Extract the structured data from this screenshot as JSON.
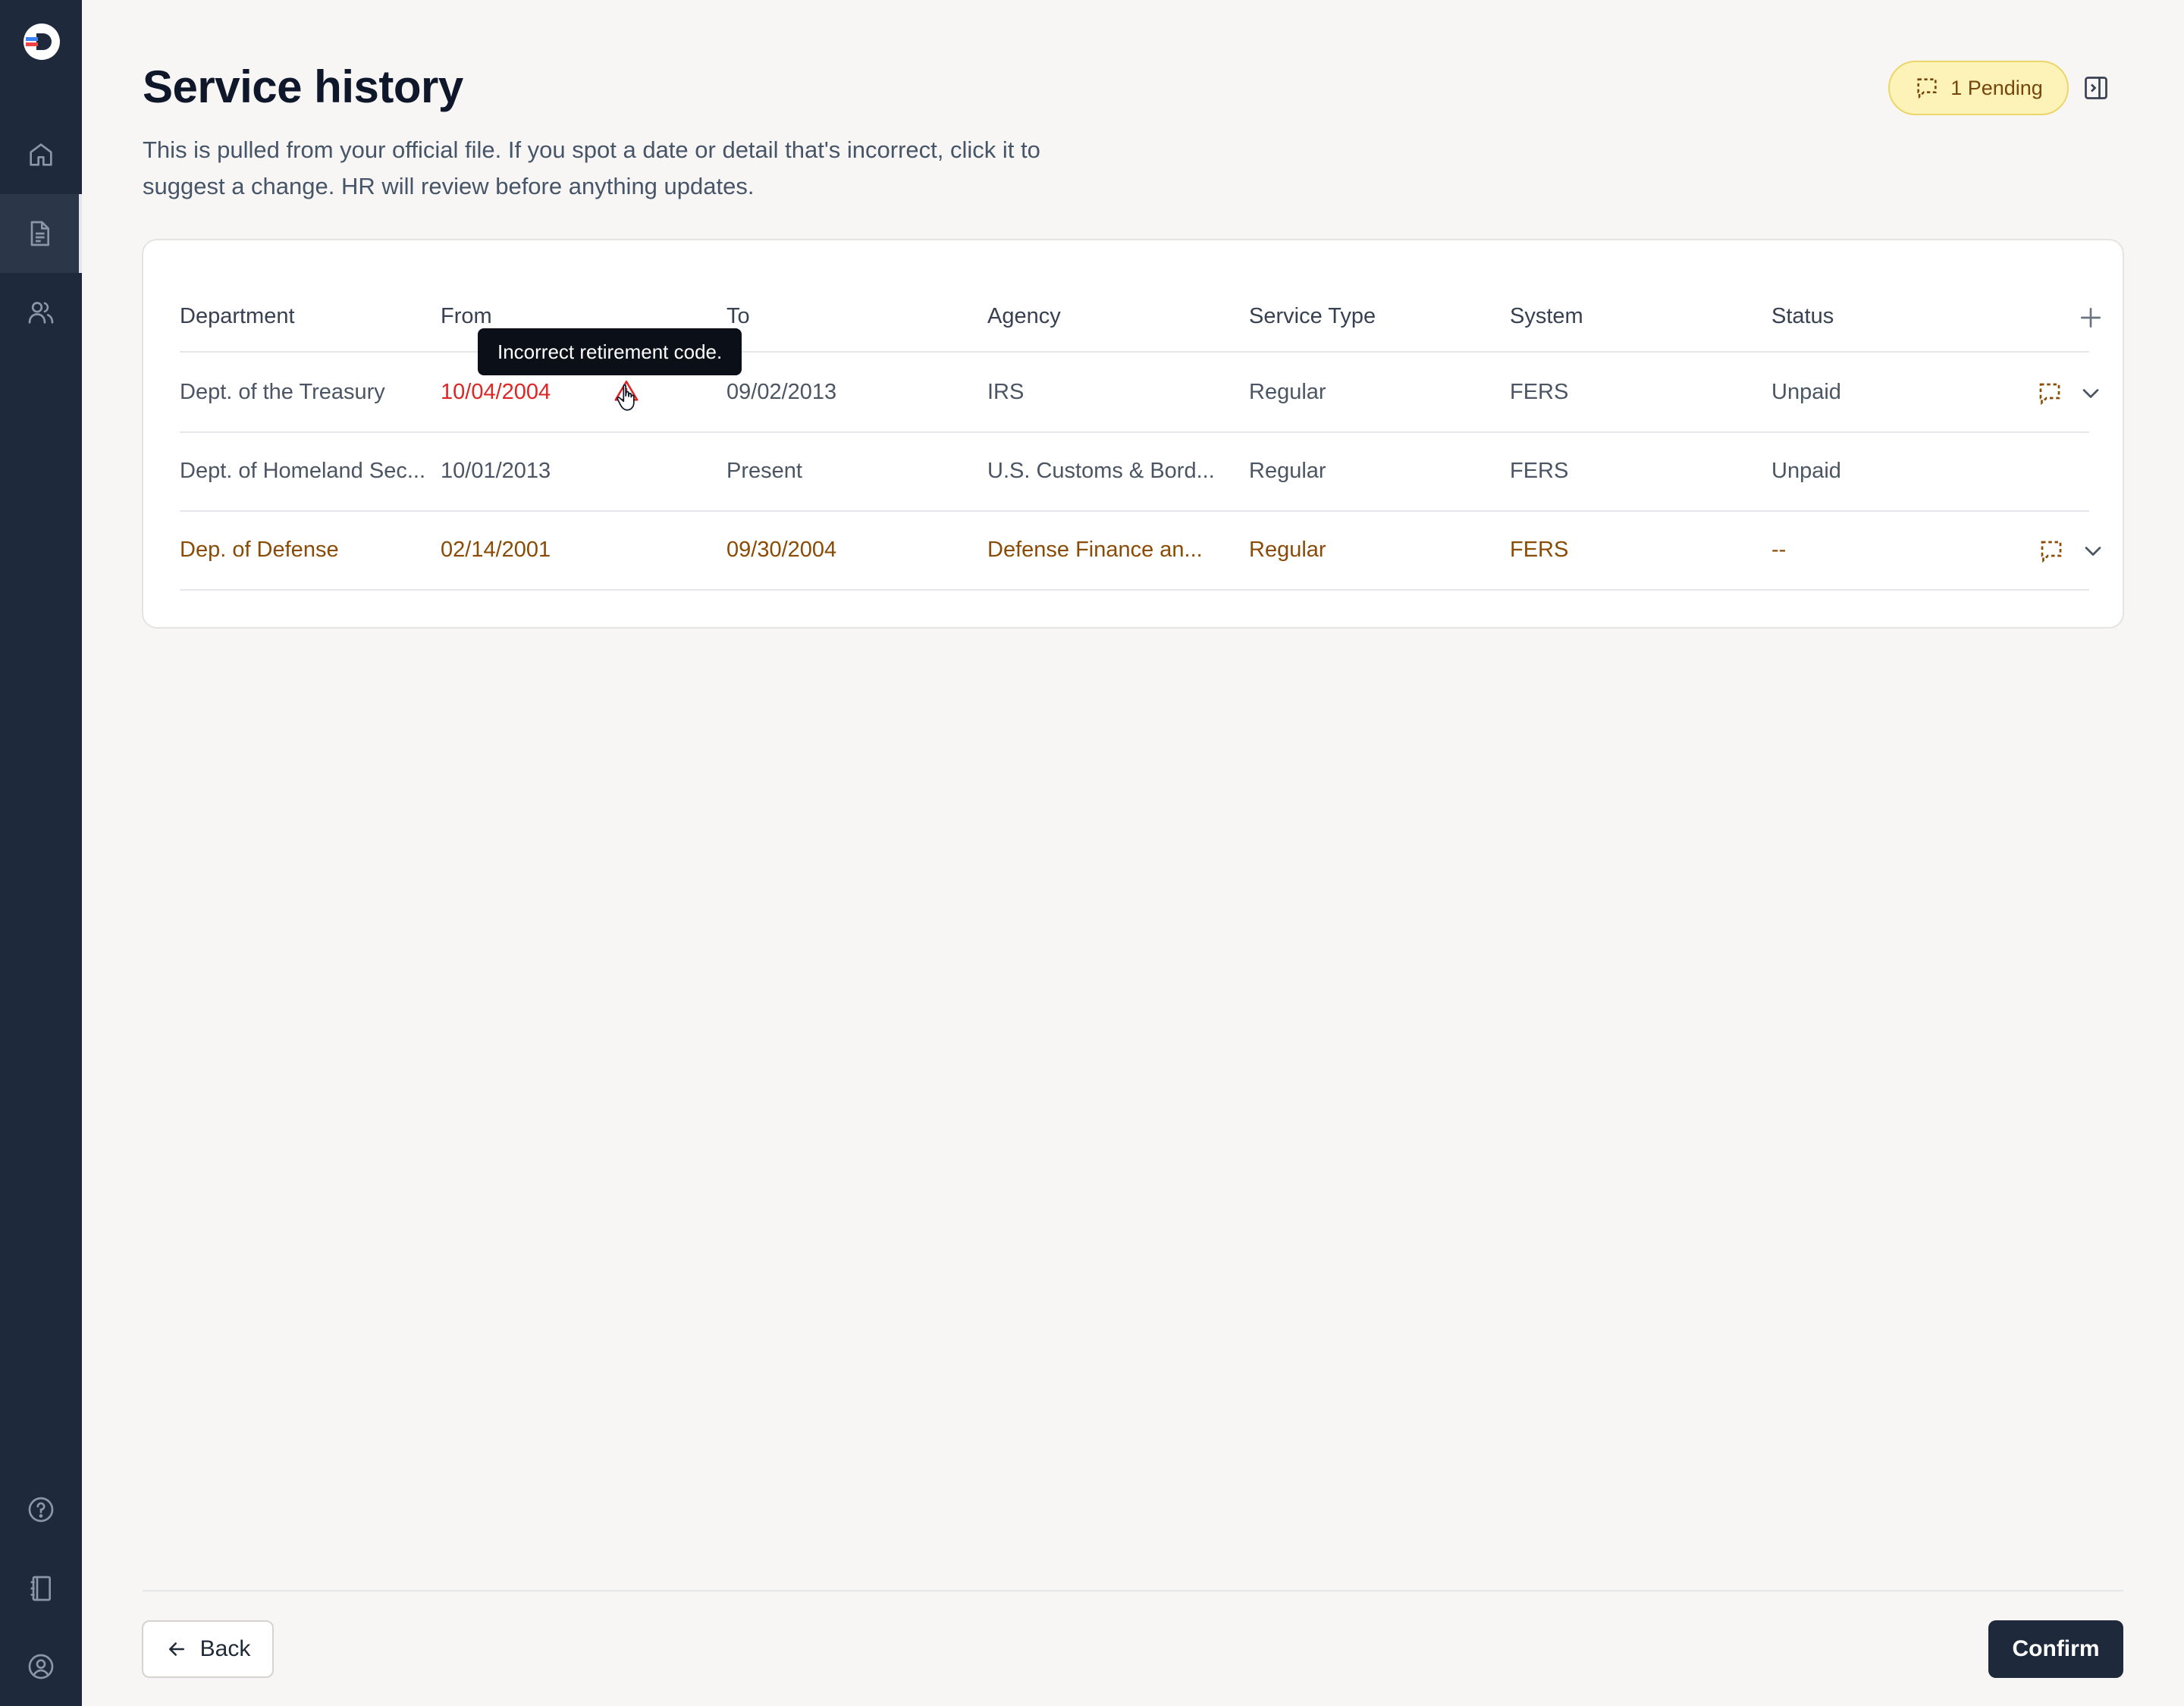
{
  "page": {
    "title": "Service history",
    "subtitle": "This is pulled from your official file. If you spot a date or detail that's incorrect, click it to suggest a change. HR will review before anything updates."
  },
  "header": {
    "pending_label": "1 Pending"
  },
  "table": {
    "columns": [
      "Department",
      "From",
      "To",
      "Agency",
      "Service Type",
      "System",
      "Status"
    ],
    "rows": [
      {
        "department": "Dept. of the Treasury",
        "from": "10/04/2004",
        "to": "09/02/2013",
        "agency": "IRS",
        "service_type": "Regular",
        "system": "FERS",
        "status": "Unpaid"
      },
      {
        "department": "Dept. of Homeland Sec...",
        "from": "10/01/2013",
        "to": "Present",
        "agency": "U.S. Customs & Bord...",
        "service_type": "Regular",
        "system": "FERS",
        "status": "Unpaid"
      },
      {
        "department": "Dep. of Defense",
        "from": "02/14/2001",
        "to": "09/30/2004",
        "agency": "Defense Finance an...",
        "service_type": "Regular",
        "system": "FERS",
        "status": "--"
      }
    ]
  },
  "tooltip": {
    "text": "Incorrect retirement code."
  },
  "footer": {
    "back_label": "Back",
    "confirm_label": "Confirm"
  },
  "colors": {
    "sidebar": "#1e2a3b",
    "error": "#dc2626",
    "warning_text": "#8a4b06",
    "pending_bg": "#fdf3b8"
  },
  "icons": {
    "nav": [
      "home-icon",
      "document-icon",
      "users-icon"
    ],
    "bottom_nav": [
      "help-icon",
      "notebook-icon",
      "account-icon"
    ]
  }
}
